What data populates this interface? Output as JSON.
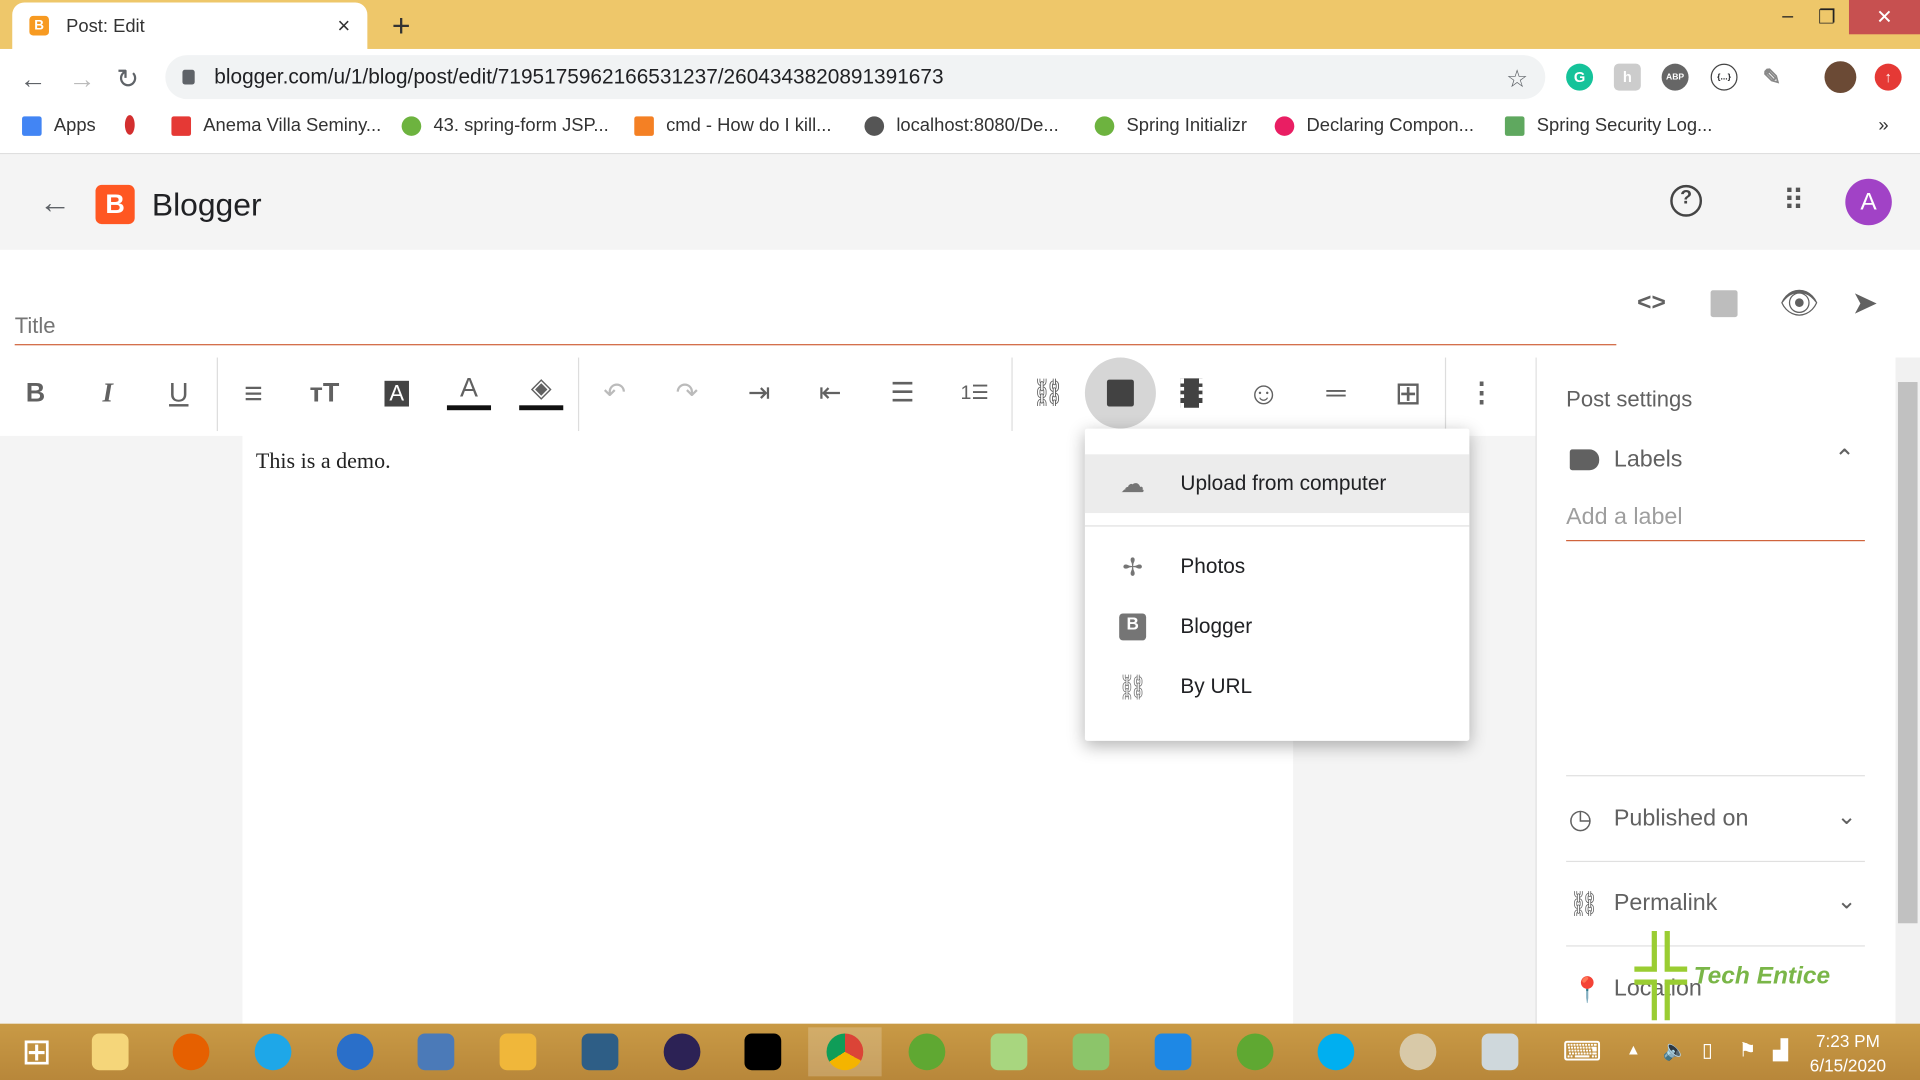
{
  "browser": {
    "tab_title": "Post: Edit",
    "tab_close": "×",
    "new_tab": "+",
    "url": "blogger.com/u/1/blog/post/edit/7195175962166531237/2604343820891391673",
    "window": {
      "minimize": "–",
      "restore": "❐",
      "close": "✕"
    },
    "bookmarks": [
      {
        "label": "Apps",
        "color": "#4285f4"
      },
      {
        "label": "",
        "color": "#d32f2f"
      },
      {
        "label": "Anema Villa Seminy...",
        "color": "#e53935"
      },
      {
        "label": "43. spring-form JSP...",
        "color": "#6db33f"
      },
      {
        "label": "cmd - How do I kill...",
        "color": "#f48024"
      },
      {
        "label": "localhost:8080/De...",
        "color": "#555555"
      },
      {
        "label": "Spring Initializr",
        "color": "#6db33f"
      },
      {
        "label": "Declaring Compon...",
        "color": "#e91e63"
      },
      {
        "label": "Spring Security Log...",
        "color": "#5fa85f"
      }
    ],
    "more_bookmarks": "»",
    "extensions": [
      "G",
      "h",
      "ABP",
      "{...}"
    ]
  },
  "app": {
    "name": "Blogger",
    "logo_letter": "B",
    "avatar_letter": "A",
    "brand_color": "#ff5722"
  },
  "editor": {
    "title_placeholder": "Title",
    "body_text": "This is a demo.",
    "toolbar": [
      "bold",
      "italic",
      "underline",
      "align",
      "font-size",
      "text-highlight",
      "text-color",
      "fill-color",
      "undo",
      "redo",
      "indent",
      "outdent",
      "bulleted-list",
      "numbered-list",
      "link",
      "insert-image",
      "insert-video",
      "emoji",
      "separator",
      "table",
      "more"
    ]
  },
  "image_menu": {
    "items": [
      {
        "label": "Upload from computer",
        "icon": "cloud-upload-icon"
      },
      {
        "label": "Photos",
        "icon": "photos-pinwheel-icon"
      },
      {
        "label": "Blogger",
        "icon": "blogger-icon"
      },
      {
        "label": "By URL",
        "icon": "link-icon"
      }
    ]
  },
  "sidebar": {
    "title": "Post settings",
    "labels": "Labels",
    "label_placeholder": "Add a label",
    "published_on": "Published on",
    "permalink": "Permalink",
    "location": "Location"
  },
  "taskbar": {
    "time": "7:23 PM",
    "date": "6/15/2020"
  },
  "watermark": "Tech Entice"
}
